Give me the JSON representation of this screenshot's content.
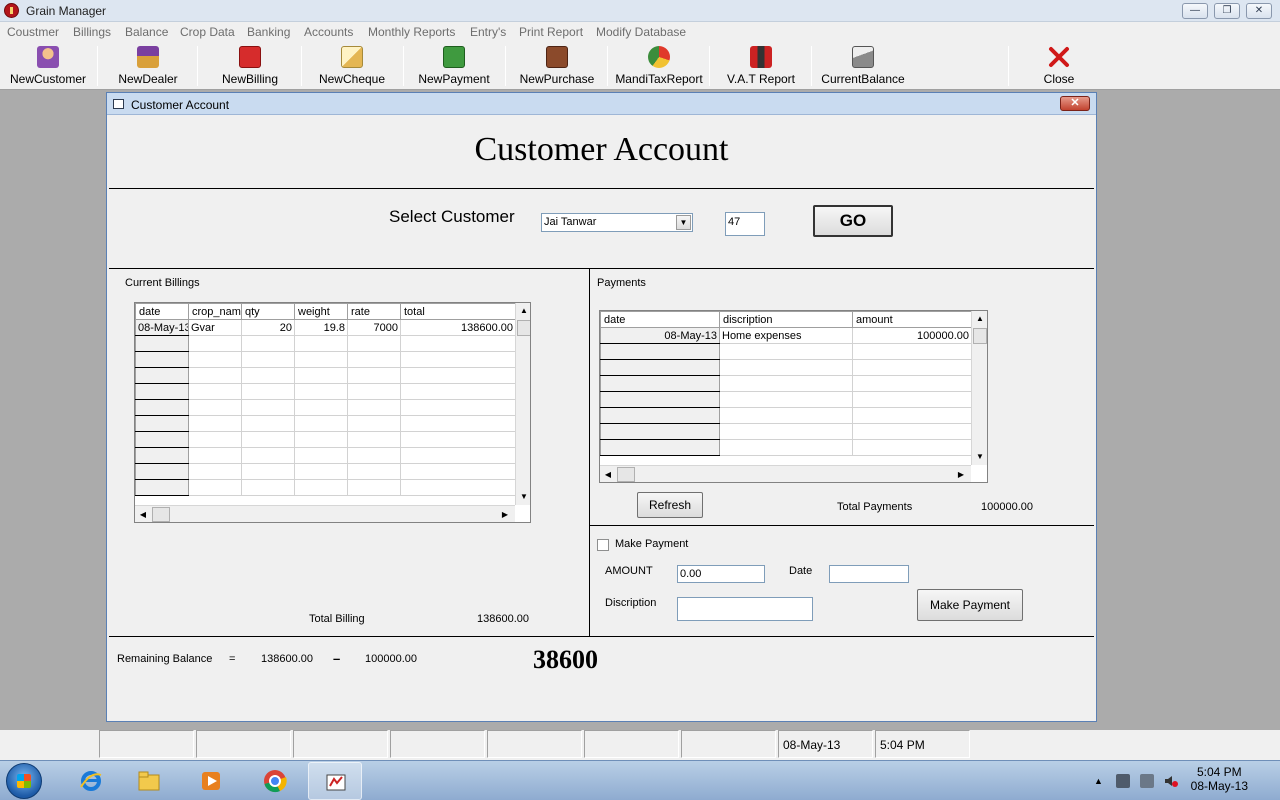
{
  "app": {
    "title": "Grain Manager"
  },
  "menu": [
    "Coustmer",
    "Billings",
    "Balance",
    "Crop Data",
    "Banking",
    "Accounts",
    "Monthly Reports",
    "Entry's",
    "Print Report",
    "Modify Database"
  ],
  "toolbar": [
    {
      "label": "NewCustomer",
      "icon": "customer-icon"
    },
    {
      "label": "NewDealer",
      "icon": "dealer-icon"
    },
    {
      "label": "NewBilling",
      "icon": "billing-icon"
    },
    {
      "label": "NewCheque",
      "icon": "cheque-icon"
    },
    {
      "label": "NewPayment",
      "icon": "payment-icon"
    },
    {
      "label": "NewPurchase",
      "icon": "purchase-icon"
    },
    {
      "label": "MandiTaxReport",
      "icon": "mandi-tax-icon"
    },
    {
      "label": "V.A.T Report",
      "icon": "vat-report-icon"
    },
    {
      "label": "CurrentBalance",
      "icon": "balance-icon"
    },
    {
      "label": "Close",
      "icon": "close-icon"
    }
  ],
  "child": {
    "title": "Customer Account",
    "heading": "Customer Account",
    "select_label": "Select Customer",
    "customer_selected": "Jai Tanwar",
    "customer_id": "47",
    "go_label": "GO"
  },
  "billings": {
    "label": "Current Billings",
    "columns": [
      "date",
      "crop_nam",
      "qty",
      "weight",
      "rate",
      "total"
    ],
    "rows": [
      [
        "08-May-13",
        "Gvar",
        "20",
        "19.8",
        "7000",
        "138600.00"
      ]
    ],
    "total_label": "Total Billing",
    "total_value": "138600.00"
  },
  "payments": {
    "label": "Payments",
    "columns": [
      "date",
      "discription",
      "amount"
    ],
    "rows": [
      [
        "08-May-13",
        "Home expenses",
        "100000.00"
      ]
    ],
    "refresh_label": "Refresh",
    "total_label": "Total Payments",
    "total_value": "100000.00"
  },
  "make_payment": {
    "checkbox_label": "Make Payment",
    "checked": false,
    "amount_label": "AMOUNT",
    "amount_value": "0.00",
    "date_label": "Date",
    "date_value": "",
    "description_label": "Discription",
    "description_value": "",
    "button_label": "Make Payment"
  },
  "balance": {
    "label": "Remaining Balance",
    "equals": "=",
    "billing": "138600.00",
    "minus": "–",
    "payments": "100000.00",
    "result": "38600"
  },
  "statusbar": {
    "date": "08-May-13",
    "time": "5:04 PM"
  },
  "taskbar": {
    "time": "5:04 PM",
    "date": "08-May-13"
  },
  "colors": {
    "workspace": "#ababab",
    "form": "#f0f0f0",
    "title_bar": "#c9dbf0",
    "close_red": "#c2432f"
  }
}
